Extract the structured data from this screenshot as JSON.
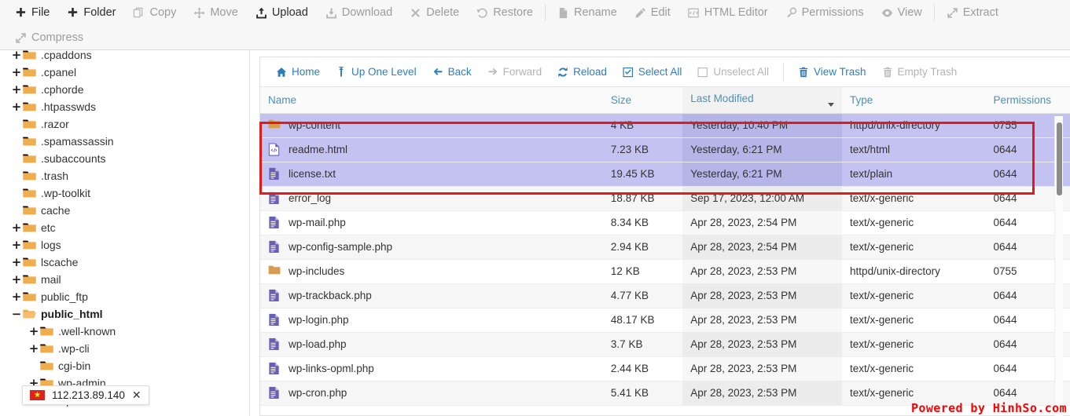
{
  "top_toolbar": {
    "row1": [
      {
        "label": "File",
        "icon": "plus-icon",
        "enabled": true
      },
      {
        "label": "Folder",
        "icon": "plus-icon",
        "enabled": true
      },
      {
        "label": "Copy",
        "icon": "copy-icon",
        "enabled": false
      },
      {
        "label": "Move",
        "icon": "move-icon",
        "enabled": false
      },
      {
        "label": "Upload",
        "icon": "upload-icon",
        "enabled": true
      },
      {
        "label": "Download",
        "icon": "download-icon",
        "enabled": false
      },
      {
        "label": "Delete",
        "icon": "x-icon",
        "enabled": false
      },
      {
        "label": "Restore",
        "icon": "restore-icon",
        "enabled": false
      },
      {
        "sep": true
      },
      {
        "label": "Rename",
        "icon": "file-icon",
        "enabled": false
      },
      {
        "label": "Edit",
        "icon": "pencil-icon",
        "enabled": false
      },
      {
        "label": "HTML Editor",
        "icon": "html-editor-icon",
        "enabled": false
      },
      {
        "label": "Permissions",
        "icon": "key-icon",
        "enabled": false
      },
      {
        "label": "View",
        "icon": "eye-icon",
        "enabled": false
      },
      {
        "sep": true
      },
      {
        "label": "Extract",
        "icon": "extract-icon",
        "enabled": false
      }
    ],
    "row2": [
      {
        "label": "Compress",
        "icon": "compress-icon",
        "enabled": false
      }
    ]
  },
  "sidebar": {
    "nodes": [
      {
        "label": ".cpaddons",
        "depth": 1,
        "expander": "+",
        "open": false,
        "current": false
      },
      {
        "label": ".cpanel",
        "depth": 1,
        "expander": "+",
        "open": false,
        "current": false
      },
      {
        "label": ".cphorde",
        "depth": 1,
        "expander": "+",
        "open": false,
        "current": false
      },
      {
        "label": ".htpasswds",
        "depth": 1,
        "expander": "+",
        "open": false,
        "current": false
      },
      {
        "label": ".razor",
        "depth": 1,
        "expander": "",
        "open": false,
        "current": false
      },
      {
        "label": ".spamassassin",
        "depth": 1,
        "expander": "",
        "open": false,
        "current": false
      },
      {
        "label": ".subaccounts",
        "depth": 1,
        "expander": "",
        "open": false,
        "current": false
      },
      {
        "label": ".trash",
        "depth": 1,
        "expander": "",
        "open": false,
        "current": false
      },
      {
        "label": ".wp-toolkit",
        "depth": 1,
        "expander": "",
        "open": false,
        "current": false
      },
      {
        "label": "cache",
        "depth": 1,
        "expander": "",
        "open": false,
        "current": false
      },
      {
        "label": "etc",
        "depth": 1,
        "expander": "+",
        "open": false,
        "current": false
      },
      {
        "label": "logs",
        "depth": 1,
        "expander": "+",
        "open": false,
        "current": false
      },
      {
        "label": "lscache",
        "depth": 1,
        "expander": "+",
        "open": false,
        "current": false
      },
      {
        "label": "mail",
        "depth": 1,
        "expander": "+",
        "open": false,
        "current": false
      },
      {
        "label": "public_ftp",
        "depth": 1,
        "expander": "+",
        "open": false,
        "current": false
      },
      {
        "label": "public_html",
        "depth": 1,
        "expander": "−",
        "open": true,
        "current": true
      },
      {
        "label": ".well-known",
        "depth": 2,
        "expander": "+",
        "open": false,
        "current": false
      },
      {
        "label": ".wp-cli",
        "depth": 2,
        "expander": "+",
        "open": false,
        "current": false
      },
      {
        "label": "cgi-bin",
        "depth": 2,
        "expander": "",
        "open": false,
        "current": false
      },
      {
        "label": "wp-admin",
        "depth": 2,
        "expander": "+",
        "open": false,
        "current": false
      },
      {
        "label": "wp-content",
        "depth": 2,
        "expander": "+",
        "open": false,
        "current": false
      }
    ]
  },
  "action_bar": [
    {
      "label": "Home",
      "icon": "home-icon",
      "enabled": true
    },
    {
      "label": "Up One Level",
      "icon": "up-arrow-icon",
      "enabled": true
    },
    {
      "label": "Back",
      "icon": "arrow-left-icon",
      "enabled": true
    },
    {
      "label": "Forward",
      "icon": "arrow-right-icon",
      "enabled": false
    },
    {
      "label": "Reload",
      "icon": "reload-icon",
      "enabled": true
    },
    {
      "label": "Select All",
      "icon": "checkbox-checked-icon",
      "enabled": true
    },
    {
      "label": "Unselect All",
      "icon": "checkbox-empty-icon",
      "enabled": false
    },
    {
      "sep": true
    },
    {
      "label": "View Trash",
      "icon": "trash-icon",
      "enabled": true
    },
    {
      "label": "Empty Trash",
      "icon": "trash-icon",
      "enabled": false
    }
  ],
  "table": {
    "columns": [
      {
        "key": "name",
        "label": "Name",
        "sorted": false
      },
      {
        "key": "size",
        "label": "Size",
        "sorted": false
      },
      {
        "key": "modified",
        "label": "Last Modified",
        "sorted": true,
        "sort_dir": "desc"
      },
      {
        "key": "type",
        "label": "Type",
        "sorted": false
      },
      {
        "key": "permissions",
        "label": "Permissions",
        "sorted": false
      }
    ],
    "rows": [
      {
        "name": "wp-content",
        "icon": "folder-icon",
        "size": "4 KB",
        "modified": "Yesterday, 10:40 PM",
        "type": "httpd/unix-directory",
        "permissions": "0755",
        "selected": true
      },
      {
        "name": "readme.html",
        "icon": "html-file-icon",
        "size": "7.23 KB",
        "modified": "Yesterday, 6:21 PM",
        "type": "text/html",
        "permissions": "0644",
        "selected": true
      },
      {
        "name": "license.txt",
        "icon": "text-file-icon",
        "size": "19.45 KB",
        "modified": "Yesterday, 6:21 PM",
        "type": "text/plain",
        "permissions": "0644",
        "selected": true
      },
      {
        "name": "error_log",
        "icon": "text-file-icon",
        "size": "18.87 KB",
        "modified": "Sep 17, 2023, 12:00 AM",
        "type": "text/x-generic",
        "permissions": "0644",
        "selected": false
      },
      {
        "name": "wp-mail.php",
        "icon": "text-file-icon",
        "size": "8.34 KB",
        "modified": "Apr 28, 2023, 2:54 PM",
        "type": "text/x-generic",
        "permissions": "0644",
        "selected": false
      },
      {
        "name": "wp-config-sample.php",
        "icon": "text-file-icon",
        "size": "2.94 KB",
        "modified": "Apr 28, 2023, 2:54 PM",
        "type": "text/x-generic",
        "permissions": "0644",
        "selected": false
      },
      {
        "name": "wp-includes",
        "icon": "folder-icon",
        "size": "12 KB",
        "modified": "Apr 28, 2023, 2:53 PM",
        "type": "httpd/unix-directory",
        "permissions": "0755",
        "selected": false
      },
      {
        "name": "wp-trackback.php",
        "icon": "text-file-icon",
        "size": "4.77 KB",
        "modified": "Apr 28, 2023, 2:53 PM",
        "type": "text/x-generic",
        "permissions": "0644",
        "selected": false
      },
      {
        "name": "wp-login.php",
        "icon": "text-file-icon",
        "size": "48.17 KB",
        "modified": "Apr 28, 2023, 2:53 PM",
        "type": "text/x-generic",
        "permissions": "0644",
        "selected": false
      },
      {
        "name": "wp-load.php",
        "icon": "text-file-icon",
        "size": "3.7 KB",
        "modified": "Apr 28, 2023, 2:53 PM",
        "type": "text/x-generic",
        "permissions": "0644",
        "selected": false
      },
      {
        "name": "wp-links-opml.php",
        "icon": "text-file-icon",
        "size": "2.44 KB",
        "modified": "Apr 28, 2023, 2:53 PM",
        "type": "text/x-generic",
        "permissions": "0644",
        "selected": false
      },
      {
        "name": "wp-cron.php",
        "icon": "text-file-icon",
        "size": "5.41 KB",
        "modified": "Apr 28, 2023, 2:53 PM",
        "type": "text/x-generic",
        "permissions": "0644",
        "selected": false
      }
    ]
  },
  "ip_badge": {
    "ip": "112.213.89.140",
    "close": "✕",
    "flag": "vietnam-flag",
    "star": "★"
  },
  "watermark": {
    "text": "Powered by HinhSo.com"
  },
  "colors": {
    "link": "#2e7eb8",
    "disabled": "#b4b4b4",
    "selection_bg": "#c3c2f0",
    "selection_outline": "#e01b1b",
    "folder": "#f0ad4e",
    "watermark": "#ff0000"
  }
}
